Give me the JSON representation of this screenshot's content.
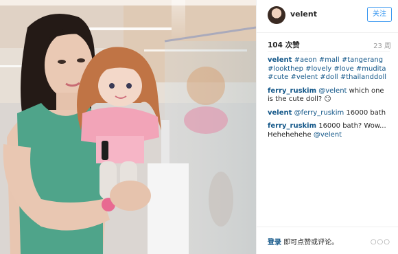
{
  "post": {
    "username": "velent",
    "follow_label": "关注",
    "likes": "104 次赞",
    "time_ago": "23 周"
  },
  "comments": [
    {
      "user": "velent",
      "text": "#aeon #mall #tangerang #lookthep #lovely #love #mudita #cute #velent #doll #thailanddoll"
    },
    {
      "user": "ferry_ruskim",
      "mention": "@velent",
      "text": "which one is the cute doll? 😏"
    },
    {
      "user": "velent",
      "mention": "@ferry_ruskim",
      "text": "16000 bath"
    },
    {
      "user": "ferry_ruskim",
      "text": "16000 bath? Wow... Hehehehehe",
      "mention": "@velent"
    }
  ],
  "footer": {
    "login_link": "登录",
    "login_text": "即可点赞或评论。",
    "more_icon": "ellipsis-icon",
    "more_glyph": "○○○"
  }
}
